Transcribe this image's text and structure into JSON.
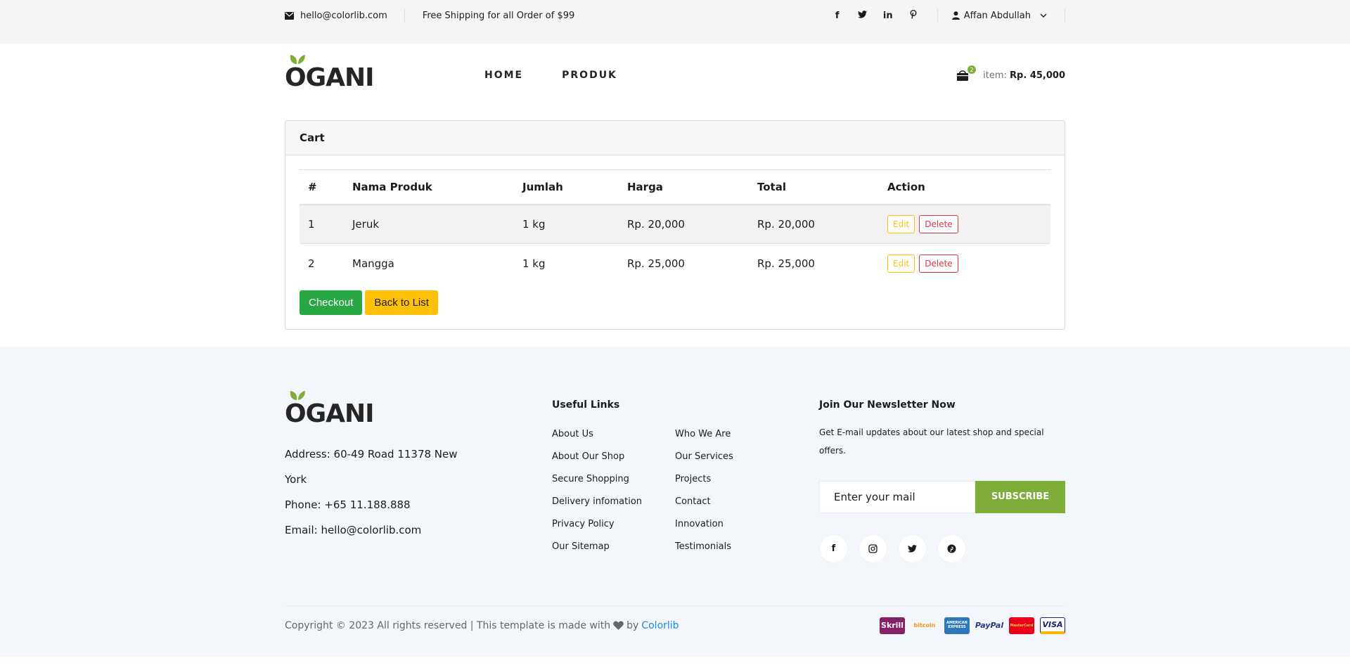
{
  "topbar": {
    "email": "hello@colorlib.com",
    "shipping": "Free Shipping for all Order of $99",
    "user": "Affan Abdullah"
  },
  "header": {
    "logo": "OGANI",
    "nav": [
      "HOME",
      "PRODUK"
    ],
    "cart_count": "2",
    "item_label": "item:",
    "item_total": "Rp. 45,000"
  },
  "cart": {
    "title": "Cart",
    "columns": [
      "#",
      "Nama Produk",
      "Jumlah",
      "Harga",
      "Total",
      "Action"
    ],
    "rows": [
      {
        "no": "1",
        "name": "Jeruk",
        "qty": "1 kg",
        "price": "Rp. 20,000",
        "total": "Rp. 20,000"
      },
      {
        "no": "2",
        "name": "Mangga",
        "qty": "1 kg",
        "price": "Rp. 25,000",
        "total": "Rp. 25,000"
      }
    ],
    "edit_label": "Edit",
    "delete_label": "Delete",
    "checkout_label": "Checkout",
    "back_label": "Back to List"
  },
  "footer": {
    "logo": "OGANI",
    "address": "Address: 60-49 Road 11378 New York",
    "phone": "Phone: +65 11.188.888",
    "email": "Email: hello@colorlib.com",
    "useful_links_title": "Useful Links",
    "links_col1": [
      "About Us",
      "About Our Shop",
      "Secure Shopping",
      "Delivery infomation",
      "Privacy Policy",
      "Our Sitemap"
    ],
    "links_col2": [
      "Who We Are",
      "Our Services",
      "Projects",
      "Contact",
      "Innovation",
      "Testimonials"
    ],
    "newsletter_title": "Join Our Newsletter Now",
    "newsletter_text": "Get E-mail updates about our latest shop and special offers.",
    "newsletter_placeholder": "Enter your mail",
    "subscribe_label": "SUBSCRIBE",
    "copyright": "Copyright © 2023 All rights reserved | This template is made with",
    "copyright_by": "by",
    "copyright_link": "Colorlib",
    "payments": [
      "Skrill",
      "bitcoin",
      "AMERICAN EXPRESS",
      "PayPal",
      "MasterCard",
      "VISA"
    ]
  },
  "colors": {
    "accent": "#7fad39",
    "success": "#28a745",
    "warning": "#ffc107",
    "danger": "#dc3545"
  }
}
